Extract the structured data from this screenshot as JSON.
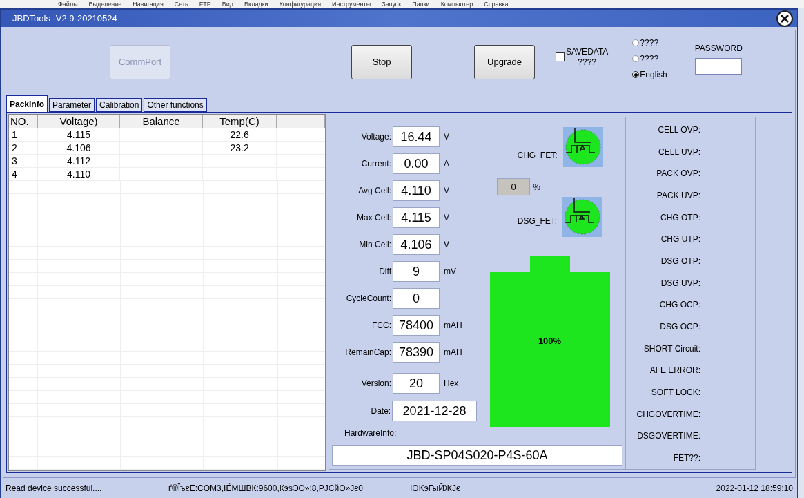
{
  "background_menu": [
    "Файлы",
    "Выделение",
    "Навигация",
    "Сеть",
    "FTP",
    "Вид",
    "Вкладки",
    "Конфигурация",
    "Инструменты",
    "Запуск",
    "Папки",
    "Компьютер",
    "Справка"
  ],
  "window": {
    "title": "JBDTools -V2.9-20210524"
  },
  "toolbar": {
    "buttons": [
      {
        "label": "CommPort",
        "disabled": true
      },
      {
        "label": "Stop",
        "disabled": false
      },
      {
        "label": "Upgrade",
        "disabled": false
      }
    ],
    "savedata": {
      "label": "SAVEDATA",
      "sublabel": "????",
      "checked": false
    },
    "languages": [
      {
        "label": "????",
        "selected": false
      },
      {
        "label": "????",
        "selected": false
      },
      {
        "label": "English",
        "selected": true
      }
    ],
    "password": {
      "label": "PASSWORD"
    }
  },
  "tabs": [
    {
      "label": "PackInfo",
      "selected": true
    },
    {
      "label": "Parameter",
      "selected": false
    },
    {
      "label": "Calibration",
      "selected": false
    },
    {
      "label": "Other functions",
      "selected": false
    }
  ],
  "cell_table": {
    "columns": [
      "NO.",
      "Voltage)",
      "Balance",
      "Temp(C)"
    ],
    "rows": [
      {
        "no": "1",
        "voltage": "4.115",
        "temp": "22.6"
      },
      {
        "no": "2",
        "voltage": "4.106",
        "temp": "23.2"
      },
      {
        "no": "3",
        "voltage": "4.112"
      },
      {
        "no": "4",
        "voltage": "4.110"
      }
    ]
  },
  "readings": [
    {
      "label": "Voltage:",
      "value": "16.44",
      "unit": "V"
    },
    {
      "label": "Current:",
      "value": "0.00",
      "unit": "A"
    },
    {
      "label": "Avg Cell:",
      "value": "4.110",
      "unit": "V"
    },
    {
      "label": "Max Cell:",
      "value": "4.115",
      "unit": "V"
    },
    {
      "label": "Min Cell:",
      "value": "4.106",
      "unit": "V"
    },
    {
      "label": "Diff",
      "value": "9",
      "unit": "mV"
    },
    {
      "label": "CycleCount:",
      "value": "0"
    },
    {
      "label": "FCC:",
      "value": "78400",
      "unit": "mAH"
    },
    {
      "label": "RemainCap:",
      "value": "78390",
      "unit": "mAH"
    }
  ],
  "info": [
    {
      "label": "Version:",
      "value": "20",
      "unit": "Hex"
    },
    {
      "label": "Date:",
      "value": "2021-12-28"
    }
  ],
  "fets": [
    {
      "label": "CHG_FET:",
      "on": true
    },
    {
      "label": "DSG_FET:",
      "on": true
    }
  ],
  "percent_box": {
    "value": "0",
    "unit": "%"
  },
  "battery": {
    "level": 1,
    "label": "100%"
  },
  "hardware": {
    "label": "HardwareInfo:",
    "value": "JBD-SP04S020-P4S-60A"
  },
  "protections": [
    "CELL OVP:",
    "CELL UVP:",
    "PACK OVP:",
    "PACK UVP:",
    "CHG OTP:",
    "CHG UTP:",
    "DSG OTP:",
    "DSG UVP:",
    "CHG OCP:",
    "DSG OCP:",
    "SHORT Circuit:",
    "AFE ERROR:",
    "SOFT LOCK:",
    "CHGOVERTIME:",
    "DSGOVERTIME:",
    "FET??:"
  ],
  "status_bar": [
    "Read device successful....",
    "ґ®ЇъєЕ:COM3,ІЁМШВК:9600,КэѕЭО»:8,РЈСйО»Јє0",
    "IOKэГыЙЖЈє",
    "2022-01-12 18:59:10"
  ]
}
